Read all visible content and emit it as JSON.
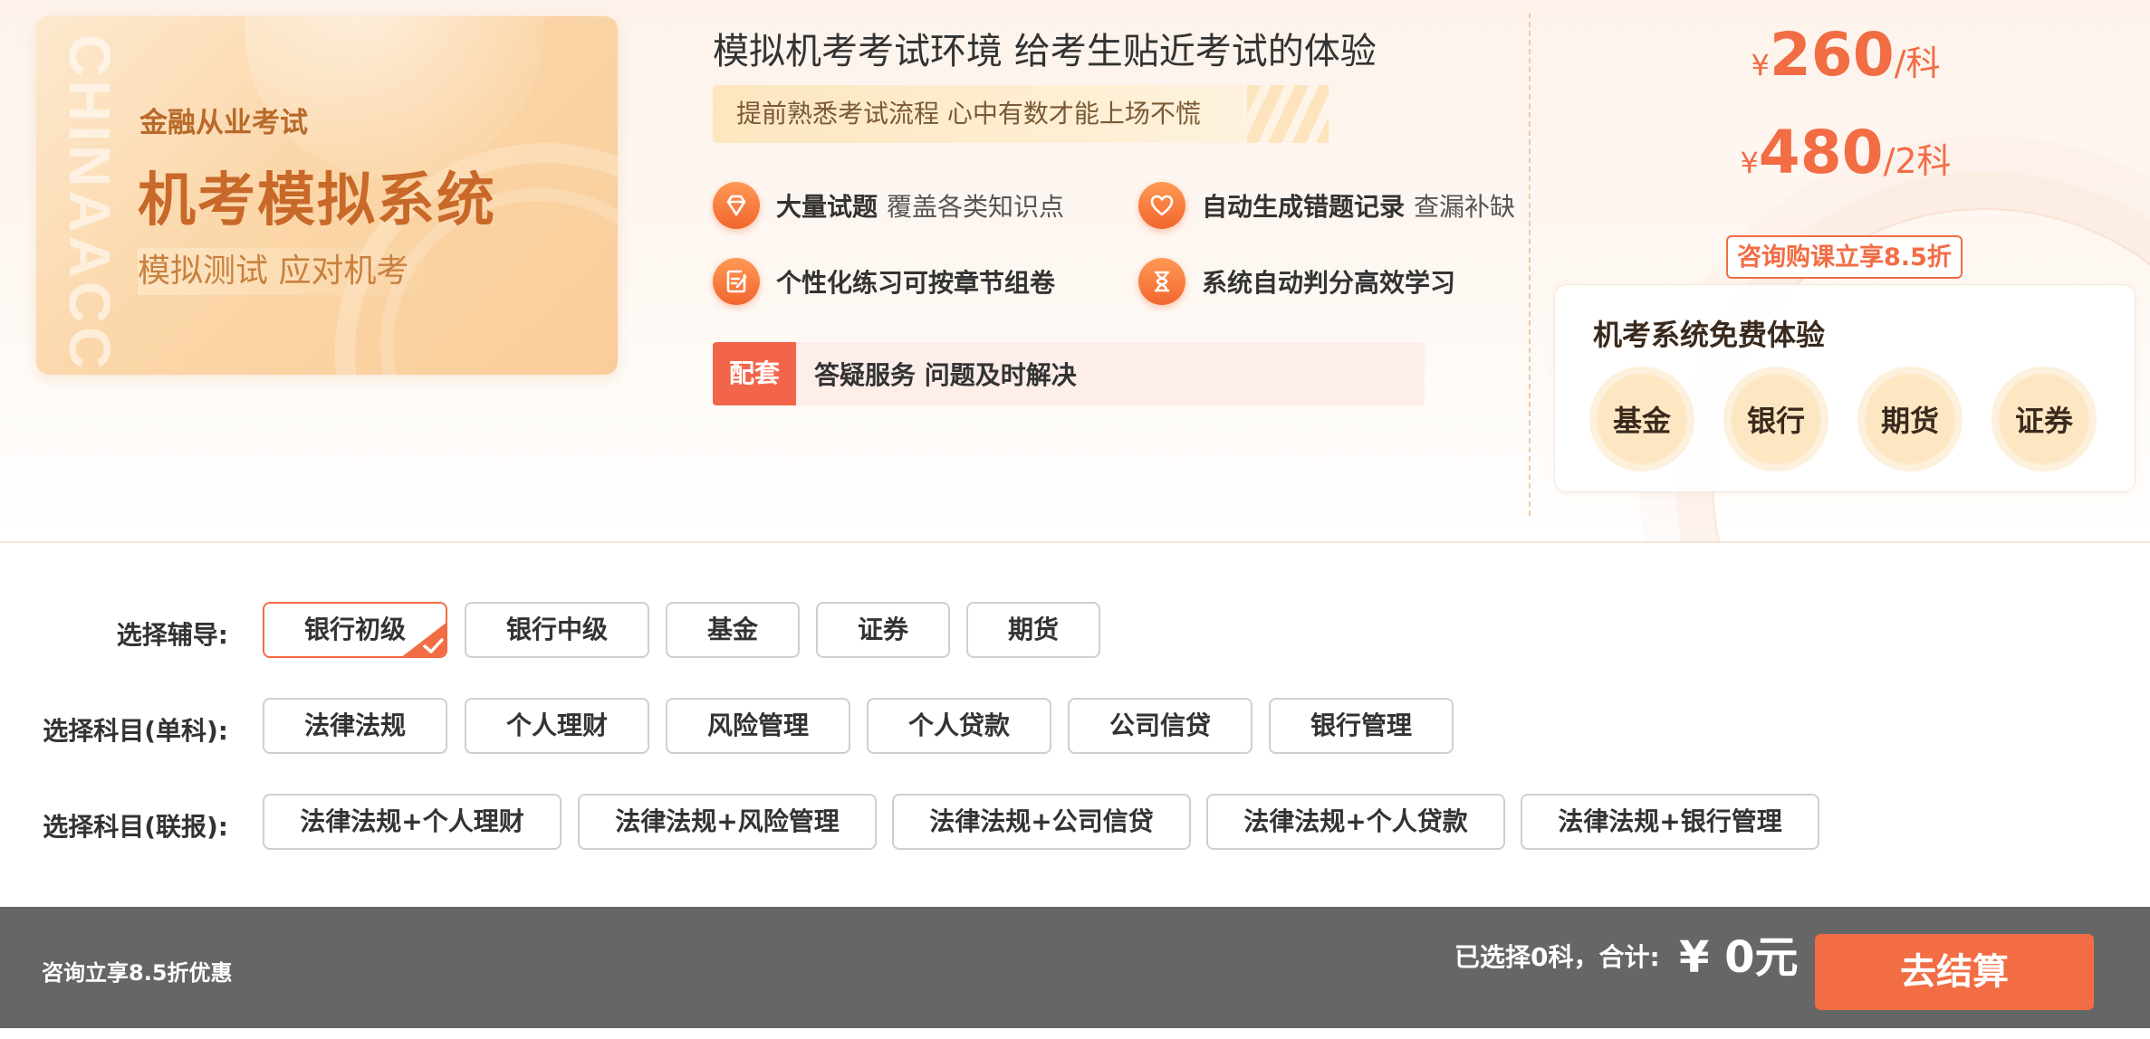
{
  "banner": {
    "vertical_text": "CHINAACC",
    "subtitle": "金融从业考试",
    "title": "机考模拟系统",
    "tag": "模拟测试 应对机考"
  },
  "headline": "模拟机考考试环境 给考生贴近考试的体验",
  "subbar": "提前熟悉考试流程 心中有数才能上场不慌",
  "features": [
    {
      "icon": "diamond-icon",
      "bold": "大量试题",
      "light": "覆盖各类知识点"
    },
    {
      "icon": "heart-icon",
      "bold": "自动生成错题记录",
      "light": "查漏补缺"
    },
    {
      "icon": "document-edit-icon",
      "bold": "个性化练习可按章节组卷",
      "light": ""
    },
    {
      "icon": "hourglass-icon",
      "bold": "系统自动判分高效学习",
      "light": ""
    }
  ],
  "support": {
    "tag": "配套",
    "text": "答疑服务 问题及时解决"
  },
  "prices": [
    {
      "currency": "¥",
      "amount": "260",
      "unit": "/科"
    },
    {
      "currency": "¥",
      "amount": "480",
      "unit": "/2科"
    }
  ],
  "discount": "咨询购课立享8.5折",
  "trial": {
    "title": "机考系统免费体验",
    "items": [
      "基金",
      "银行",
      "期货",
      "证券"
    ]
  },
  "selection": {
    "rows": [
      {
        "label": "选择辅导:",
        "options": [
          "银行初级",
          "银行中级",
          "基金",
          "证券",
          "期货"
        ],
        "selected": 0
      },
      {
        "label": "选择科目(单科):",
        "options": [
          "法律法规",
          "个人理财",
          "风险管理",
          "个人贷款",
          "公司信贷",
          "银行管理"
        ]
      },
      {
        "label": "选择科目(联报):",
        "options": [
          "法律法规+个人理财",
          "法律法规+风险管理",
          "法律法规+公司信贷",
          "法律法规+个人贷款",
          "法律法规+银行管理"
        ]
      }
    ]
  },
  "bottom": {
    "promo": "咨询立享8.5折优惠",
    "summary": "已选择0科，合计:",
    "total": "¥ 0元",
    "checkout": "去结算"
  },
  "colors": {
    "accent": "#f26c44",
    "banner_text": "#c8692a",
    "bottom_bar": "#666666"
  }
}
